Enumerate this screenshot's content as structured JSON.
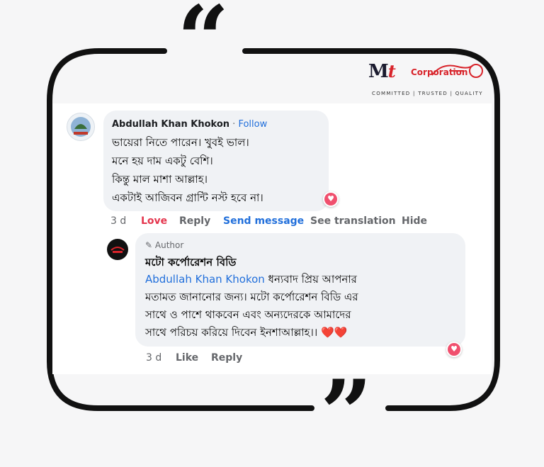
{
  "brand": {
    "logo_mark": "M",
    "logo_t": "t",
    "logo_corporation": "Corporation",
    "logo_tagline": "COMMITTED | TRUSTED | QUALITY",
    "colors": {
      "red": "#d8232a",
      "dark": "#1b1b2f"
    }
  },
  "quote_marks": {
    "open": "“",
    "close": "”"
  },
  "comment": {
    "author": "Abdullah Khan Khokon",
    "separator": " · ",
    "follow_label": "Follow",
    "lines": [
      "ভায়েরা নিতে পারেন। খুবই ভাল।",
      "মনে হয় দাম একটু বেশি।",
      "কিন্তু মাল মাশা আল্লাহ।",
      "একটাই আজিবন গ্রান্টি নস্ট হবে না।"
    ],
    "reaction_icon": "love-reaction-icon",
    "actions": {
      "time": "3 d",
      "love": "Love",
      "reply": "Reply",
      "send_message": "Send message",
      "see_translation": "See translation",
      "hide": "Hide"
    }
  },
  "reply": {
    "badge_label": "Author",
    "author": "মটো কর্পোরেশন বিডি",
    "mention": "Abdullah Khan Khokon",
    "line1_rest": " ধন্যবাদ প্রিয় আপনার",
    "lines": [
      "মতামত জানানোর জন্য। মটো কর্পোরেশন বিডি এর",
      "সাথে ও পাশে থাকবেন এবং অন্যদেরকে আমাদের",
      "সাথে পরিচয় করিয়ে দিবেন ইনশাআল্লাহ।। ❤️❤️"
    ],
    "reaction_icon": "love-reaction-icon",
    "actions": {
      "time": "3 d",
      "like": "Like",
      "reply": "Reply"
    }
  },
  "colors": {
    "link_blue": "#216fdb",
    "love_red": "#e4354d",
    "bubble_bg": "#f0f2f5",
    "meta_gray": "#65676b"
  }
}
